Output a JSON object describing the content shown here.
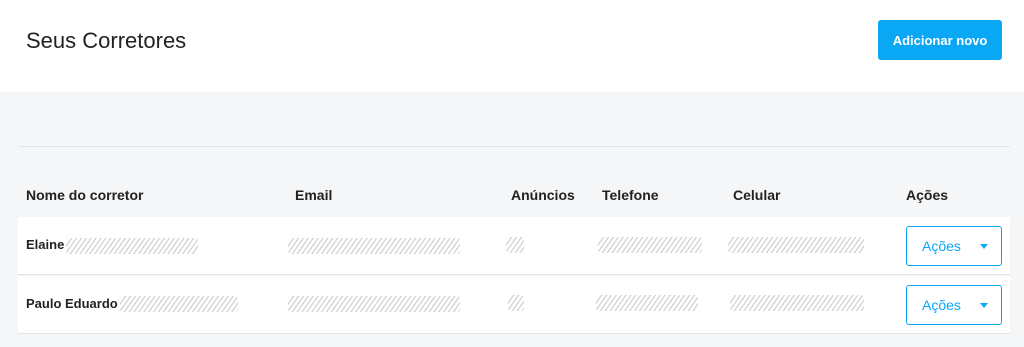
{
  "header": {
    "title": "Seus Corretores",
    "add_button_label": "Adicionar novo"
  },
  "table": {
    "columns": [
      "Nome do corretor",
      "Email",
      "Anúncios",
      "Telefone",
      "Celular",
      "Ações"
    ],
    "rows": [
      {
        "name": "Elaine",
        "actions_label": "Ações"
      },
      {
        "name": "Paulo Eduardo",
        "actions_label": "Ações"
      }
    ]
  },
  "colors": {
    "accent": "#0aa7f5",
    "background": "#f5f6f8",
    "surface": "#ffffff"
  },
  "icons": [
    "chevron-down-icon"
  ]
}
